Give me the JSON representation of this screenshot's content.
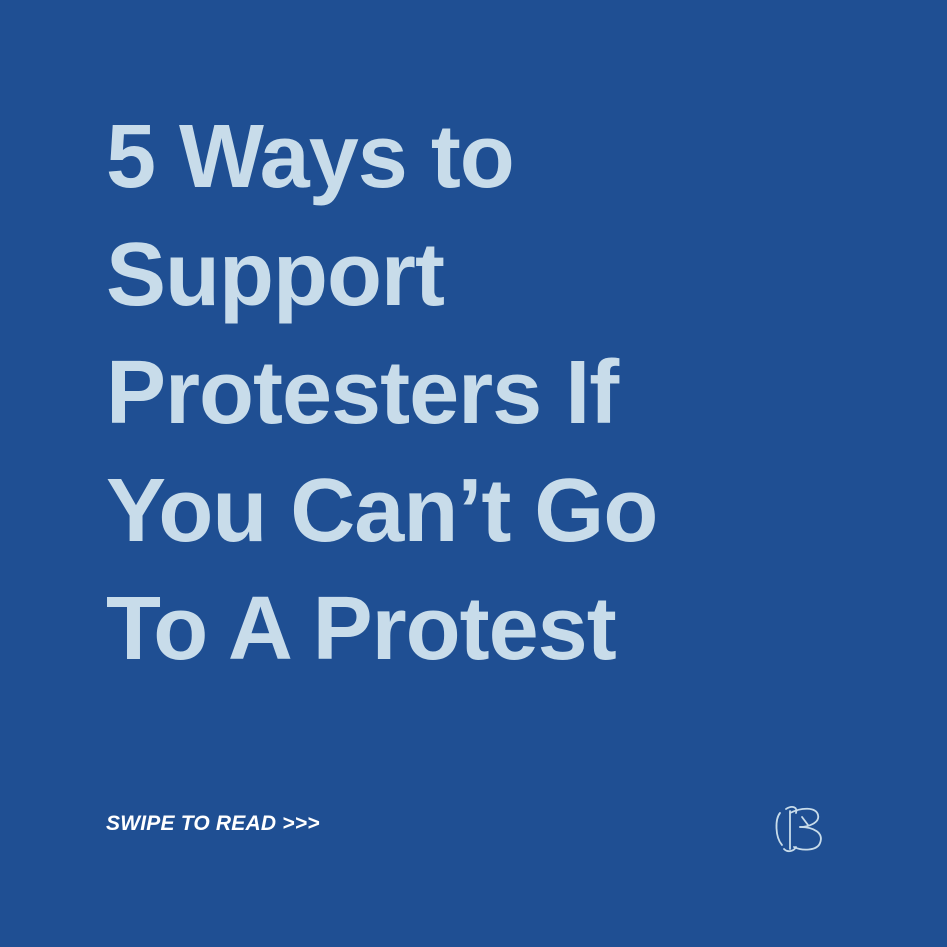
{
  "background_color": "#1f4f93",
  "headline_color": "#c8dcea",
  "headline": {
    "lines": [
      "5 Ways to",
      "Support",
      "Protesters If",
      "You Can’t Go",
      "To A Protest"
    ]
  },
  "swipe_cta": "SWIPE TO READ >>>",
  "logo": {
    "icon": "monogram-logo-icon"
  }
}
